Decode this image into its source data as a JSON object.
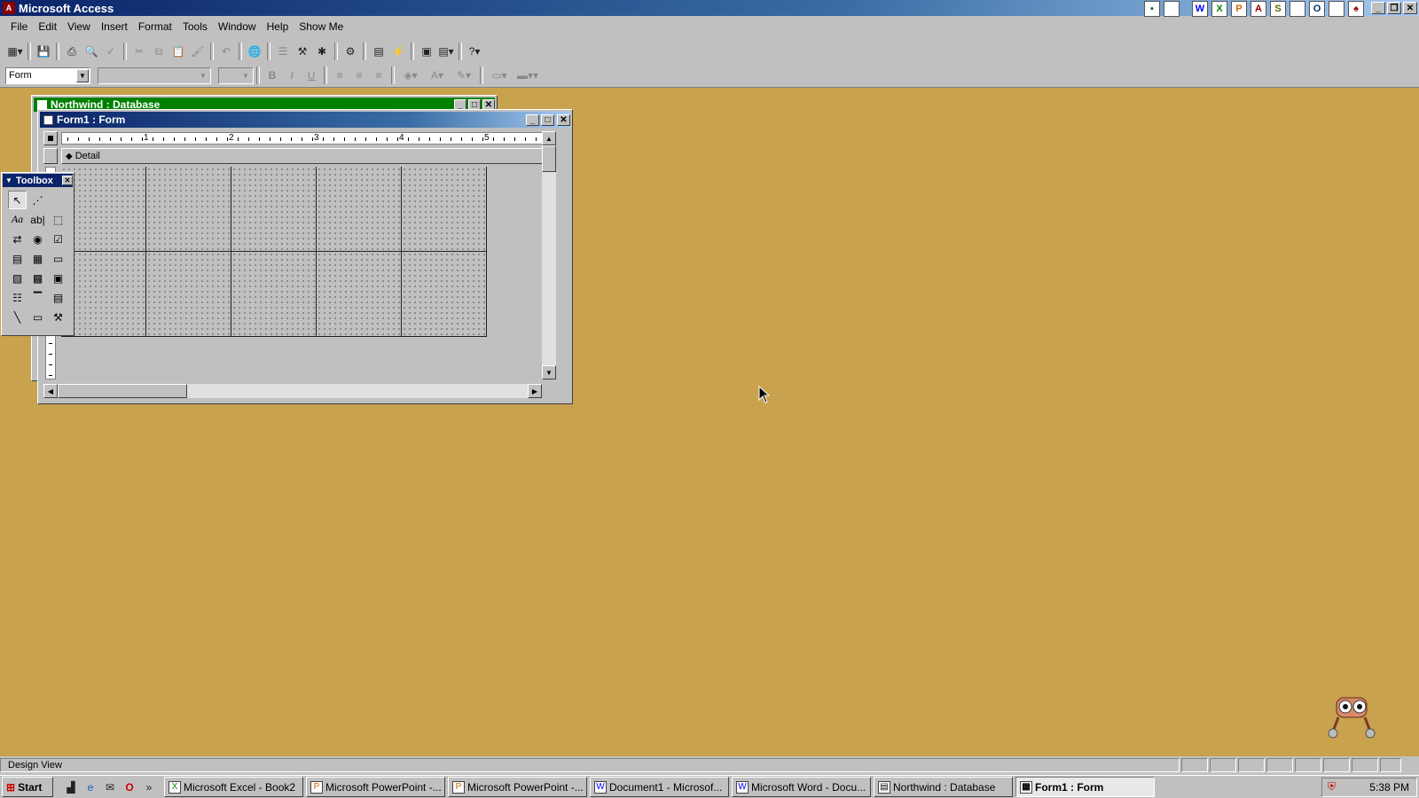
{
  "app": {
    "title": "Microsoft Access",
    "status_text": "Design View"
  },
  "menu": [
    "File",
    "Edit",
    "View",
    "Insert",
    "Format",
    "Tools",
    "Window",
    "Help",
    "Show Me"
  ],
  "format_toolbar": {
    "object_combo": "Form",
    "font_combo": "",
    "size_combo": ""
  },
  "db_window": {
    "title": "Northwind : Database"
  },
  "form_window": {
    "title": "Form1 : Form",
    "section_label": "Detail",
    "ruler_numbers": [
      "1",
      "2",
      "3",
      "4",
      "5"
    ]
  },
  "toolbox": {
    "title": "Toolbox"
  },
  "taskbar": {
    "start_label": "Start",
    "buttons": [
      {
        "label": "Microsoft Excel - Book2",
        "icon": "excel-icon"
      },
      {
        "label": "Microsoft PowerPoint -...",
        "icon": "powerpoint-icon"
      },
      {
        "label": "Microsoft PowerPoint -...",
        "icon": "powerpoint-icon"
      },
      {
        "label": "Document1 - Microsof...",
        "icon": "word-icon"
      },
      {
        "label": "Microsoft Word - Docu...",
        "icon": "word-icon"
      },
      {
        "label": "Northwind : Database",
        "icon": "database-icon"
      },
      {
        "label": "Form1 : Form",
        "icon": "form-icon",
        "active": true
      }
    ],
    "clock": "5:38 PM"
  },
  "colors": {
    "desktop": "#c9a24e",
    "titlebar_active": "#0a246a",
    "titlebar_inactive_db": "#008000",
    "face": "#c0c0c0"
  }
}
